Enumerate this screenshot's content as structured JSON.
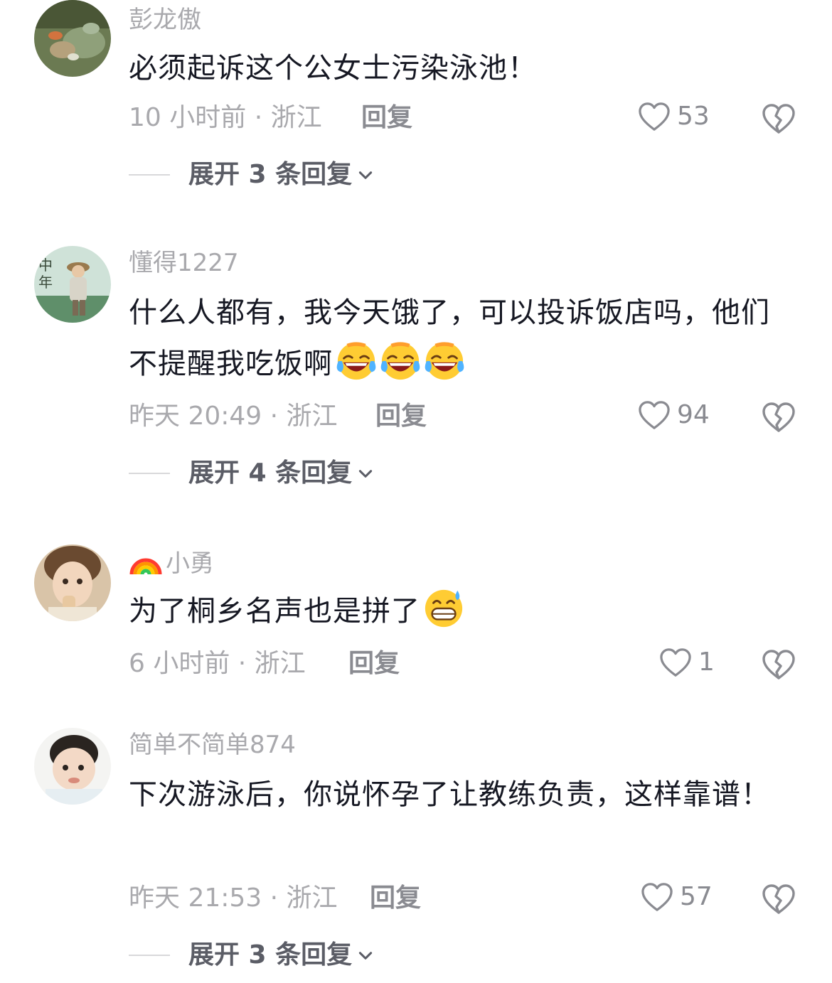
{
  "comments": [
    {
      "username": "彭龙傲",
      "text": "必须起诉这个公女士污染泳池！",
      "time_location": "10 小时前 · 浙江",
      "reply_label": "回复",
      "likes": "53",
      "expand_label": "展开 3 条回复"
    },
    {
      "username": "懂得1227",
      "text": "什么人都有，我今天饿了，可以投诉饭店吗，他们不提醒我吃饭啊",
      "emoji_names": [
        "rolling-on-floor-laughing",
        "rolling-on-floor-laughing",
        "rolling-on-floor-laughing"
      ],
      "time_location": "昨天 20:49 · 浙江",
      "reply_label": "回复",
      "likes": "94",
      "expand_label": "展开 4 条回复"
    },
    {
      "username": "小勇",
      "username_prefix_icon": "rainbow-icon",
      "text": "为了桐乡名声也是拼了",
      "emoji_names": [
        "grinning-sweat"
      ],
      "time_location": "6 小时前 · 浙江",
      "reply_label": "回复",
      "likes": "1"
    },
    {
      "username": "简单不简单874",
      "text": "下次游泳后，你说怀孕了让教练负责，这样靠谱！",
      "time_location": "昨天 21:53 · 浙江",
      "reply_label": "回复",
      "likes": "57",
      "expand_label": "展开 3 条回复"
    }
  ],
  "colors": {
    "text": "#161823",
    "muted": "#a9a9ad",
    "action": "#8a8b91",
    "expand": "#5b5d66"
  }
}
